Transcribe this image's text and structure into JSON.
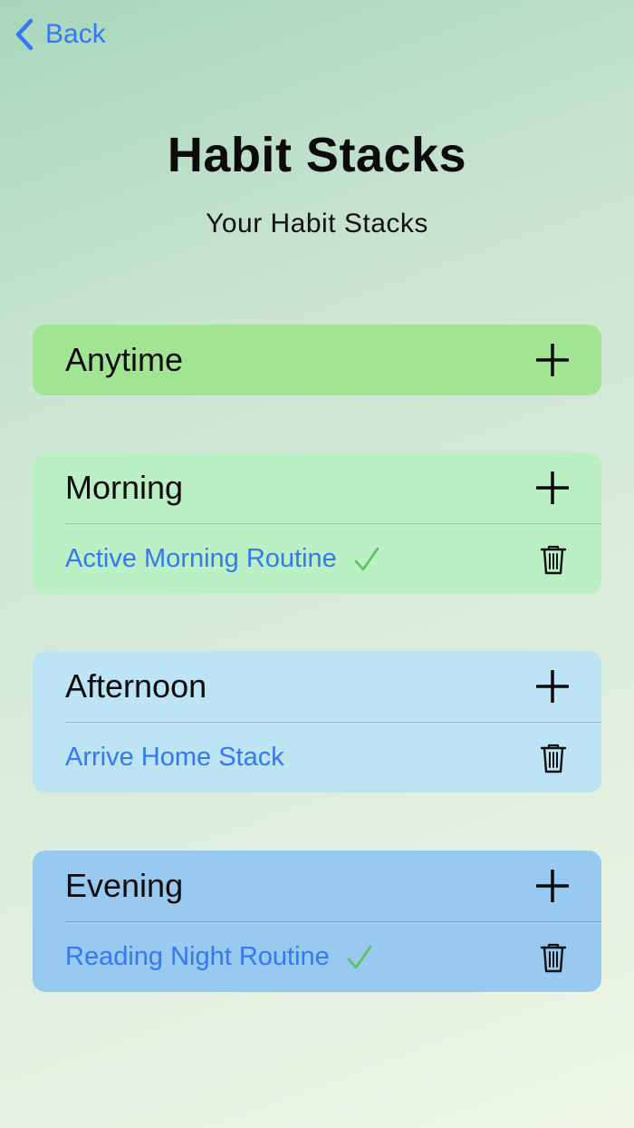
{
  "nav": {
    "back_label": "Back"
  },
  "header": {
    "title": "Habit Stacks",
    "subtitle": "Your Habit Stacks"
  },
  "colors": {
    "accent": "#3478f6",
    "check": "#5cc25c",
    "anytime": "#a1e494",
    "morning": "#baf0c3",
    "afternoon": "#bde4f4",
    "evening": "#97c9f1"
  },
  "icons": {
    "back": "chevron-left-icon",
    "add": "plus-icon",
    "done": "checkmark-icon",
    "delete": "trash-icon"
  },
  "sections": [
    {
      "title": "Anytime",
      "items": []
    },
    {
      "title": "Morning",
      "items": [
        {
          "label": "Active Morning Routine",
          "completed": true
        }
      ]
    },
    {
      "title": "Afternoon",
      "items": [
        {
          "label": "Arrive Home Stack",
          "completed": false
        }
      ]
    },
    {
      "title": "Evening",
      "items": [
        {
          "label": "Reading Night Routine",
          "completed": true
        }
      ]
    }
  ]
}
